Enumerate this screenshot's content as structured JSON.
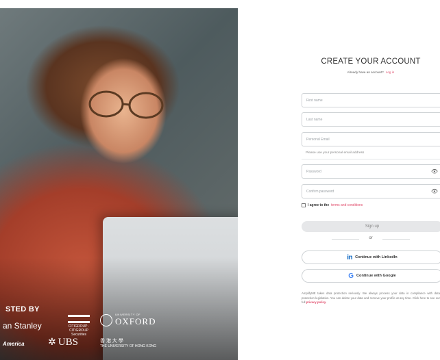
{
  "hero": {
    "trusted_label": "STED BY",
    "logos": {
      "morgan_stanley": "an Stanley",
      "citi": "CITIGROUP · CITIGROUP Securities",
      "oxford_small": "UNIVERSITY OF",
      "oxford_big": "OXFORD",
      "boa": "America",
      "ubs_keys": "✲",
      "ubs": "UBS",
      "hku_line1": "香 港 大 學",
      "hku_line2": "THE UNIVERSITY OF HONG KONG"
    }
  },
  "form": {
    "title": "CREATE YOUR ACCOUNT",
    "subtitle": "Already have an account?",
    "login_link": "Log in",
    "first_name_placeholder": "First name",
    "last_name_placeholder": "Last name",
    "email_placeholder": "Personal Email",
    "email_hint": "Please use your personal email address",
    "password_placeholder": "Password",
    "confirm_placeholder": "Confirm password",
    "eye_icon": "👁",
    "terms_prefix": "I agree to the",
    "terms_link": "terms and conditions",
    "signup_label": "Sign up",
    "or_label": "or",
    "linkedin_icon": "in",
    "linkedin_label": "Continue with LinkedIn",
    "google_icon": "G",
    "google_label": "Continue with Google",
    "privacy_text": "AmplifyME takes data protection seriously. We always process your data in compliance with data protection legislation. You can delete your data and remove your profile at any time. Click here to see our full",
    "privacy_link": "privacy policy."
  }
}
